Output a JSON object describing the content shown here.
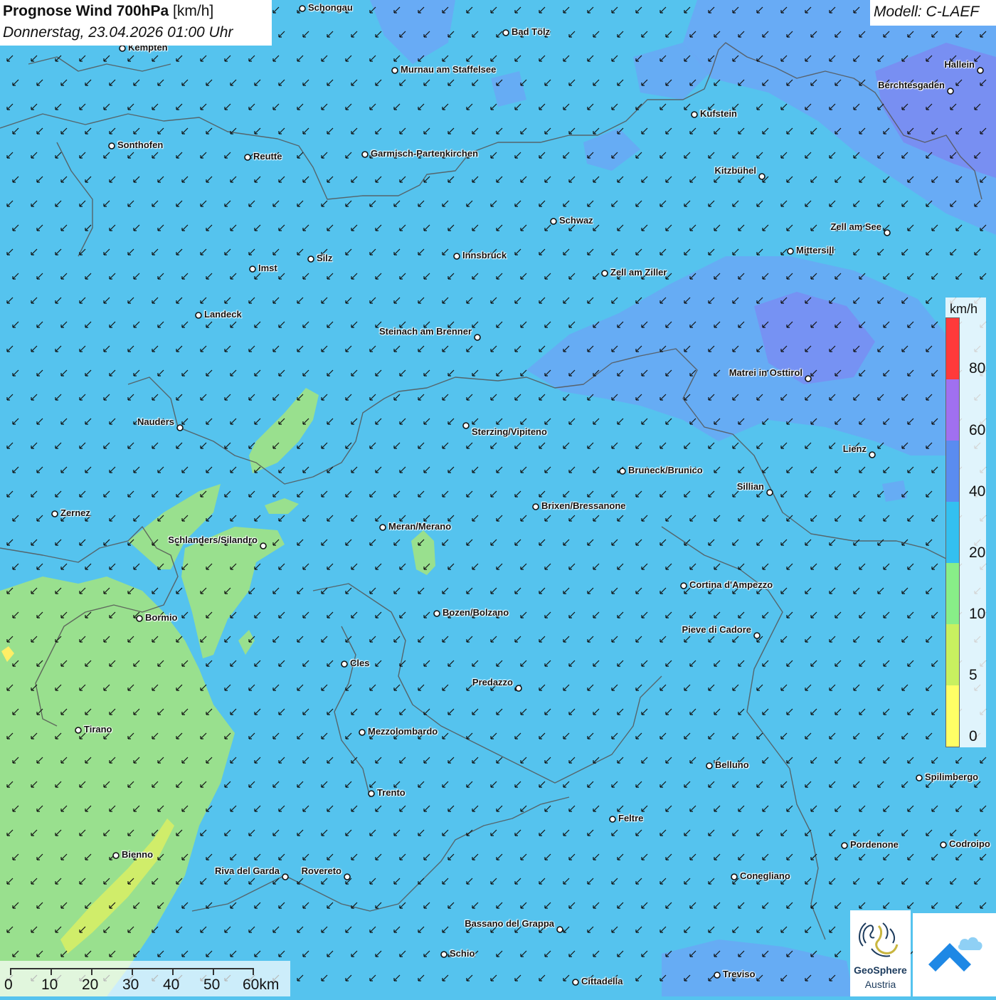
{
  "header": {
    "title_bold": "Prognose Wind 700hPa",
    "title_unit": " [km/h]",
    "datetime": "Donnerstag, 23.04.2026 01:00 Uhr",
    "model": "Modell: C-LAEF"
  },
  "legend": {
    "unit": "km/h",
    "ticks": [
      "80",
      "60",
      "40",
      "20",
      "10",
      "5",
      "0"
    ],
    "colors": [
      "#ff3a3a",
      "#a070f0",
      "#5a8cf0",
      "#33c0f0",
      "#88ee88",
      "#c8f060",
      "#ffff66"
    ]
  },
  "scale_bar": {
    "labels": [
      "0",
      "10",
      "20",
      "30",
      "40",
      "50",
      "60km"
    ]
  },
  "colors": {
    "background": "#55c3ee",
    "band_40_60": "#7a8cf2",
    "band_20_40": "#6aa8f5",
    "band_10_20": "#99e08e",
    "band_5_10": "#d6ee66",
    "border": "#555555"
  },
  "wind": {
    "direction": "from north-east (arrows pointing south-west)"
  },
  "cities": [
    {
      "name": "Schongau"
    },
    {
      "name": "Kempten"
    },
    {
      "name": "Bad Tölz"
    },
    {
      "name": "Murnau am Staffelsee"
    },
    {
      "name": "Hallein"
    },
    {
      "name": "Berchtesgaden"
    },
    {
      "name": "Kufstein"
    },
    {
      "name": "Sonthofen"
    },
    {
      "name": "Reutte"
    },
    {
      "name": "Garmisch-Partenkirchen"
    },
    {
      "name": "Kitzbühel"
    },
    {
      "name": "Schwaz"
    },
    {
      "name": "Zell am See"
    },
    {
      "name": "Mittersill"
    },
    {
      "name": "Silz"
    },
    {
      "name": "Innsbruck"
    },
    {
      "name": "Imst"
    },
    {
      "name": "Zell am Ziller"
    },
    {
      "name": "Landeck"
    },
    {
      "name": "Steinach am Brenner"
    },
    {
      "name": "Matrei in Osttirol"
    },
    {
      "name": "Nauders"
    },
    {
      "name": "Sterzing/Vipiteno"
    },
    {
      "name": "Lienz"
    },
    {
      "name": "Bruneck/Brunico"
    },
    {
      "name": "Sillian"
    },
    {
      "name": "Brixen/Bressanone"
    },
    {
      "name": "Zernez"
    },
    {
      "name": "Meran/Merano"
    },
    {
      "name": "Schlanders/Silandro"
    },
    {
      "name": "Cortina d'Ampezzo"
    },
    {
      "name": "Bozen/Bolzano"
    },
    {
      "name": "Bormio"
    },
    {
      "name": "Pieve di Cadore"
    },
    {
      "name": "Cles"
    },
    {
      "name": "Predazzo"
    },
    {
      "name": "Tirano"
    },
    {
      "name": "Mezzolombardo"
    },
    {
      "name": "Belluno"
    },
    {
      "name": "Spilimbergo"
    },
    {
      "name": "Trento"
    },
    {
      "name": "Feltre"
    },
    {
      "name": "Pordenone"
    },
    {
      "name": "Codroipo"
    },
    {
      "name": "Bienno"
    },
    {
      "name": "Riva del Garda"
    },
    {
      "name": "Rovereto"
    },
    {
      "name": "Conegliano"
    },
    {
      "name": "Bassano del Grappa"
    },
    {
      "name": "Schio"
    },
    {
      "name": "Treviso"
    },
    {
      "name": "Cittadella"
    }
  ],
  "logo": {
    "line1": "GeoSphere",
    "line2": "Austria"
  }
}
